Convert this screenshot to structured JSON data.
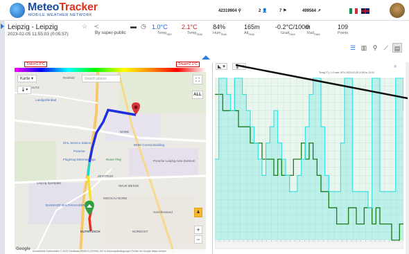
{
  "app": {
    "logo_title_1": "Meteo",
    "logo_title_2": "Tracker",
    "logo_subtitle": "MOBILE WEATHER NETWORK"
  },
  "topstats": [
    {
      "value": "42319904",
      "icon": "map-pin-icon"
    },
    {
      "value": "2",
      "icon": "user-icon"
    },
    {
      "value": "7",
      "icon": "route-icon"
    },
    {
      "value": "499564",
      "icon": "arrow-icon"
    }
  ],
  "track": {
    "title": "Leipzig - Leipzig",
    "date": "2023-02-05 11:55:03 (0:05:57)",
    "by": "By super-public"
  },
  "measurements": [
    {
      "value": "1.0°C",
      "label": "Temp",
      "sub": "min",
      "color": "#1a5fd4"
    },
    {
      "value": "2.1°C",
      "label": "Temp",
      "sub": "max",
      "color": "#d21a1a"
    },
    {
      "value": "84%",
      "label": "Hum",
      "sub": "max",
      "color": "#222222"
    },
    {
      "value": "165m",
      "label": "Alt",
      "sub": "max",
      "color": "#222222"
    },
    {
      "value": "-0.2°C/100m",
      "label": "Grad",
      "sub": "max",
      "color": "#222222"
    },
    {
      "value": "0",
      "label": "Rad",
      "sub": "max",
      "color": "#222222"
    },
    {
      "value": "109",
      "label": "Points",
      "sub": "",
      "color": "#222222"
    }
  ],
  "map": {
    "tmin_label": "Tmin=1.0°C",
    "tmax_label": "Tmax=2.1°C",
    "type_select": "Karte",
    "search_placeholder": "Search places",
    "all_button": "ALL",
    "zoom_in": "+",
    "zoom_out": "−",
    "places": [
      "Reinfeld",
      "SCHLAUTZ",
      "Landgrafenbad",
      "NORD",
      "BMW Central Building",
      "DHL Service Station",
      "Porsche",
      "Rover Play",
      "Flugzeug Dämmerungs",
      "Porsche Leipzig Auto-Zentrum",
      "ZENTRUM",
      "MOCKAU NORD",
      "NEUE MESSE",
      "Leipzig Sportplatz",
      "BAHNHOF BALTIKHAUSEN",
      "EUTRITZSCH",
      "NORDOST",
      "Gerichtsstand"
    ],
    "footer": "Kurzbefehle  Kartendaten © 2023 GeoBasis-DE/BKG (©2009)  200 m  Nutzungsbedingungen  Fehler bei Google Maps melden",
    "google_text": "Google"
  },
  "chart_data": {
    "type": "line",
    "series": [
      {
        "color": "#1a7a1a",
        "values": [
          9,
          9,
          8,
          8,
          8,
          8,
          7,
          7,
          7,
          6,
          6,
          6,
          5,
          5,
          5,
          4,
          5,
          4,
          4,
          4,
          5,
          5,
          6,
          5,
          6,
          5,
          4,
          3,
          3,
          2,
          2,
          1,
          1,
          1,
          2,
          2,
          1,
          1,
          2,
          2,
          1,
          2,
          1,
          1,
          1,
          0,
          0,
          1,
          1
        ]
      },
      {
        "color": "#2fe0e0",
        "values": [
          5,
          10,
          10,
          9,
          8,
          10,
          10,
          9,
          8,
          7,
          6,
          5,
          4,
          6,
          7,
          8,
          6,
          5,
          4,
          3,
          3,
          4,
          5,
          7,
          9,
          10,
          10,
          7,
          4,
          3,
          3,
          3,
          6,
          10,
          10,
          3,
          3,
          3,
          3,
          2,
          10,
          10,
          3,
          3,
          3,
          3,
          10,
          10,
          8
        ]
      }
    ],
    "legend_text": "Temp(°C): 1.0  max  1974  2023-02-05 11:55 to 12:01",
    "grid": true
  },
  "ui": {
    "chart_tool_1": "▾",
    "chart_tool_2": "▾"
  }
}
